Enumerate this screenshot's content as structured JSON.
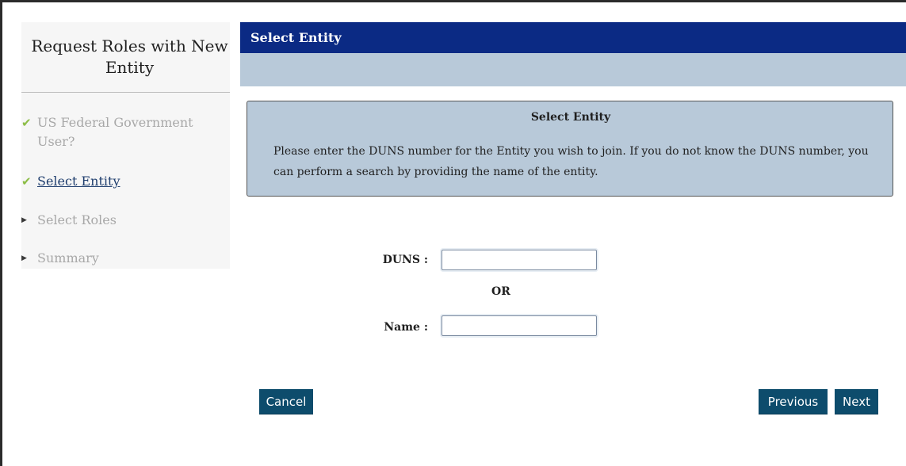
{
  "sidebar": {
    "title": "Request Roles with New Entity",
    "steps": [
      {
        "label": "US Federal Government User?",
        "status": "complete"
      },
      {
        "label": "Select Entity",
        "status": "current"
      },
      {
        "label": "Select Roles",
        "status": "pending"
      },
      {
        "label": "Summary",
        "status": "pending"
      }
    ],
    "icons": {
      "complete": "check-icon",
      "pending": "arrow-right-icon"
    }
  },
  "header": {
    "title": "Select Entity"
  },
  "info": {
    "title": "Select Entity",
    "text": "Please enter the DUNS number for the Entity you wish to join. If you do not know the DUNS number, you can perform a search by providing the name of the entity."
  },
  "form": {
    "duns_label": "DUNS :",
    "duns_value": "",
    "or_label": "OR",
    "name_label": "Name :",
    "name_value": ""
  },
  "buttons": {
    "cancel": "Cancel",
    "previous": "Previous",
    "next": "Next"
  },
  "colors": {
    "header": "#0b2a84",
    "subheader": "#b8c9d9",
    "button": "#0d4c6c",
    "check": "#8cbd46",
    "sidebar_bg": "#f6f6f6"
  }
}
